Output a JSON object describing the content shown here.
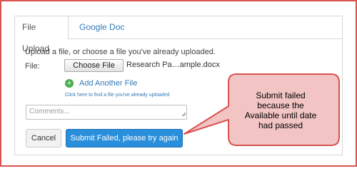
{
  "tabs": [
    {
      "label": "File Upload",
      "active": true
    },
    {
      "label": "Google Doc",
      "active": false
    }
  ],
  "upload": {
    "intro_text": "Upload a file, or choose a file you've already uploaded.",
    "file_label": "File:",
    "choose_button": "Choose File",
    "file_name": "Research Pa…ample.docx",
    "add_another_label": "Add Another File",
    "find_link": "Click here to find a file you've already uploaded"
  },
  "comments": {
    "placeholder": "Comments..."
  },
  "actions": {
    "cancel_label": "Cancel",
    "submit_label": "Submit Failed, please try again"
  },
  "callout": {
    "lines": [
      "Submit failed",
      "because the",
      "Available until date",
      "had passed"
    ]
  },
  "colors": {
    "frame_border": "#d9534f",
    "link": "#337ab7",
    "submit_bg": "#2a8fdb",
    "callout_fill": "#f2c4c4",
    "callout_border": "#d9534f",
    "add_icon": "#4cae4c"
  },
  "icons": {
    "add": "plus-circle-icon",
    "resize": "resize-grip-icon"
  }
}
